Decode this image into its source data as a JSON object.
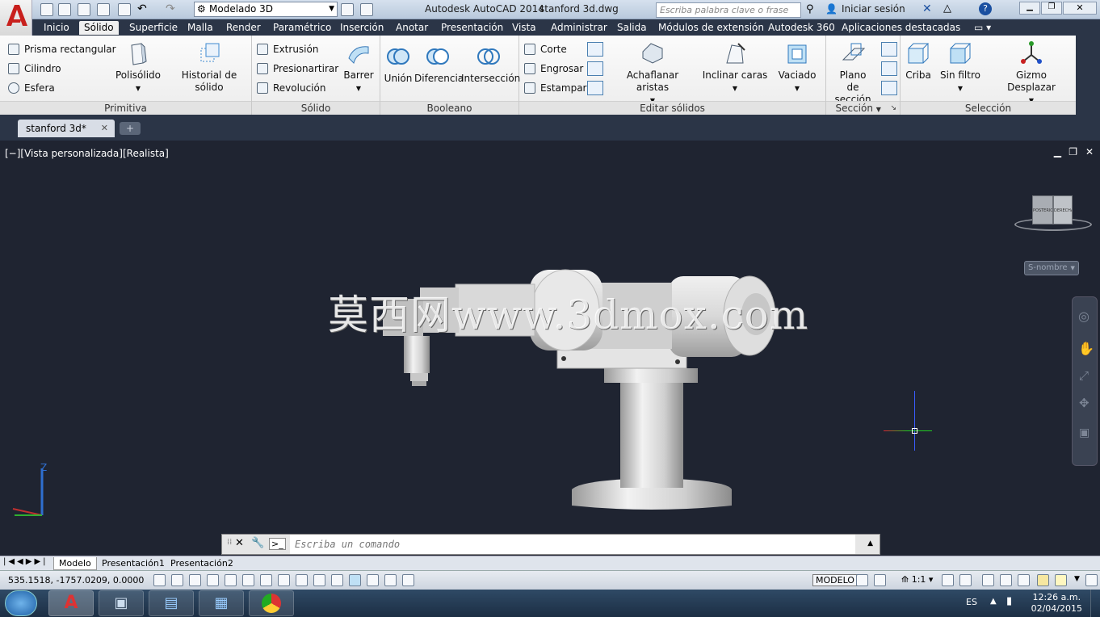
{
  "titlebar": {
    "workspace": "Modelado 3D",
    "app_title": "Autodesk AutoCAD 2014",
    "file_title": "stanford 3d.dwg",
    "search_placeholder": "Escriba palabra clave o frase",
    "signin": "Iniciar sesión"
  },
  "ribbon_tabs": [
    "Inicio",
    "Sólido",
    "Superficie",
    "Malla",
    "Render",
    "Paramétrico",
    "Inserción",
    "Anotar",
    "Presentación",
    "Vista",
    "Administrar",
    "Salida",
    "Módulos de extensión",
    "Autodesk 360",
    "Aplicaciones destacadas"
  ],
  "ribbon": {
    "primitiva": {
      "title": "Primitiva",
      "box": "Prisma rectangular",
      "cylinder": "Cilindro",
      "sphere": "Esfera",
      "polysolid": "Polisólido",
      "history": "Historial de sólido"
    },
    "solido": {
      "title": "Sólido",
      "extrude": "Extrusión",
      "presspull": "Presionartirar",
      "revolve": "Revolución",
      "sweep": "Barrer"
    },
    "booleano": {
      "title": "Booleano",
      "union": "Unión",
      "subtract": "Diferencia",
      "intersect": "Intersección"
    },
    "editar": {
      "title": "Editar sólidos",
      "slice": "Corte",
      "thicken": "Engrosar",
      "imprint": "Estampar",
      "chamfer": "Achaflanar aristas",
      "taper": "Inclinar caras",
      "shell": "Vaciado"
    },
    "seccion": {
      "title": "Sección",
      "plane_line1": "Plano",
      "plane_line2": "de sección"
    },
    "seleccion": {
      "title": "Selección",
      "culling": "Criba",
      "nofilter": "Sin filtro",
      "gizmo": "Gizmo Desplazar"
    }
  },
  "document_tab": "stanford 3d*",
  "viewport": {
    "label": "[−][Vista personalizada][Realista]",
    "watermark": "莫西网www.3dmox.com",
    "viewcube_left": "POSTERIOR",
    "viewcube_right": "DERECHA",
    "ucs_button": "S-nombre",
    "axis_z": "Z"
  },
  "command": {
    "placeholder": "Escriba un comando"
  },
  "layout_tabs": [
    "Modelo",
    "Presentación1",
    "Presentación2"
  ],
  "status": {
    "coords": "535.1518, -1757.0209, 0.0000",
    "space": "MODELO",
    "scale": "1:1"
  },
  "taskbar": {
    "lang": "ES",
    "time": "12:26 a.m.",
    "date": "02/04/2015"
  },
  "colors": {
    "background": "#1f2431",
    "ribbon_dark": "#2b3547",
    "model": "#d9d9d9"
  }
}
